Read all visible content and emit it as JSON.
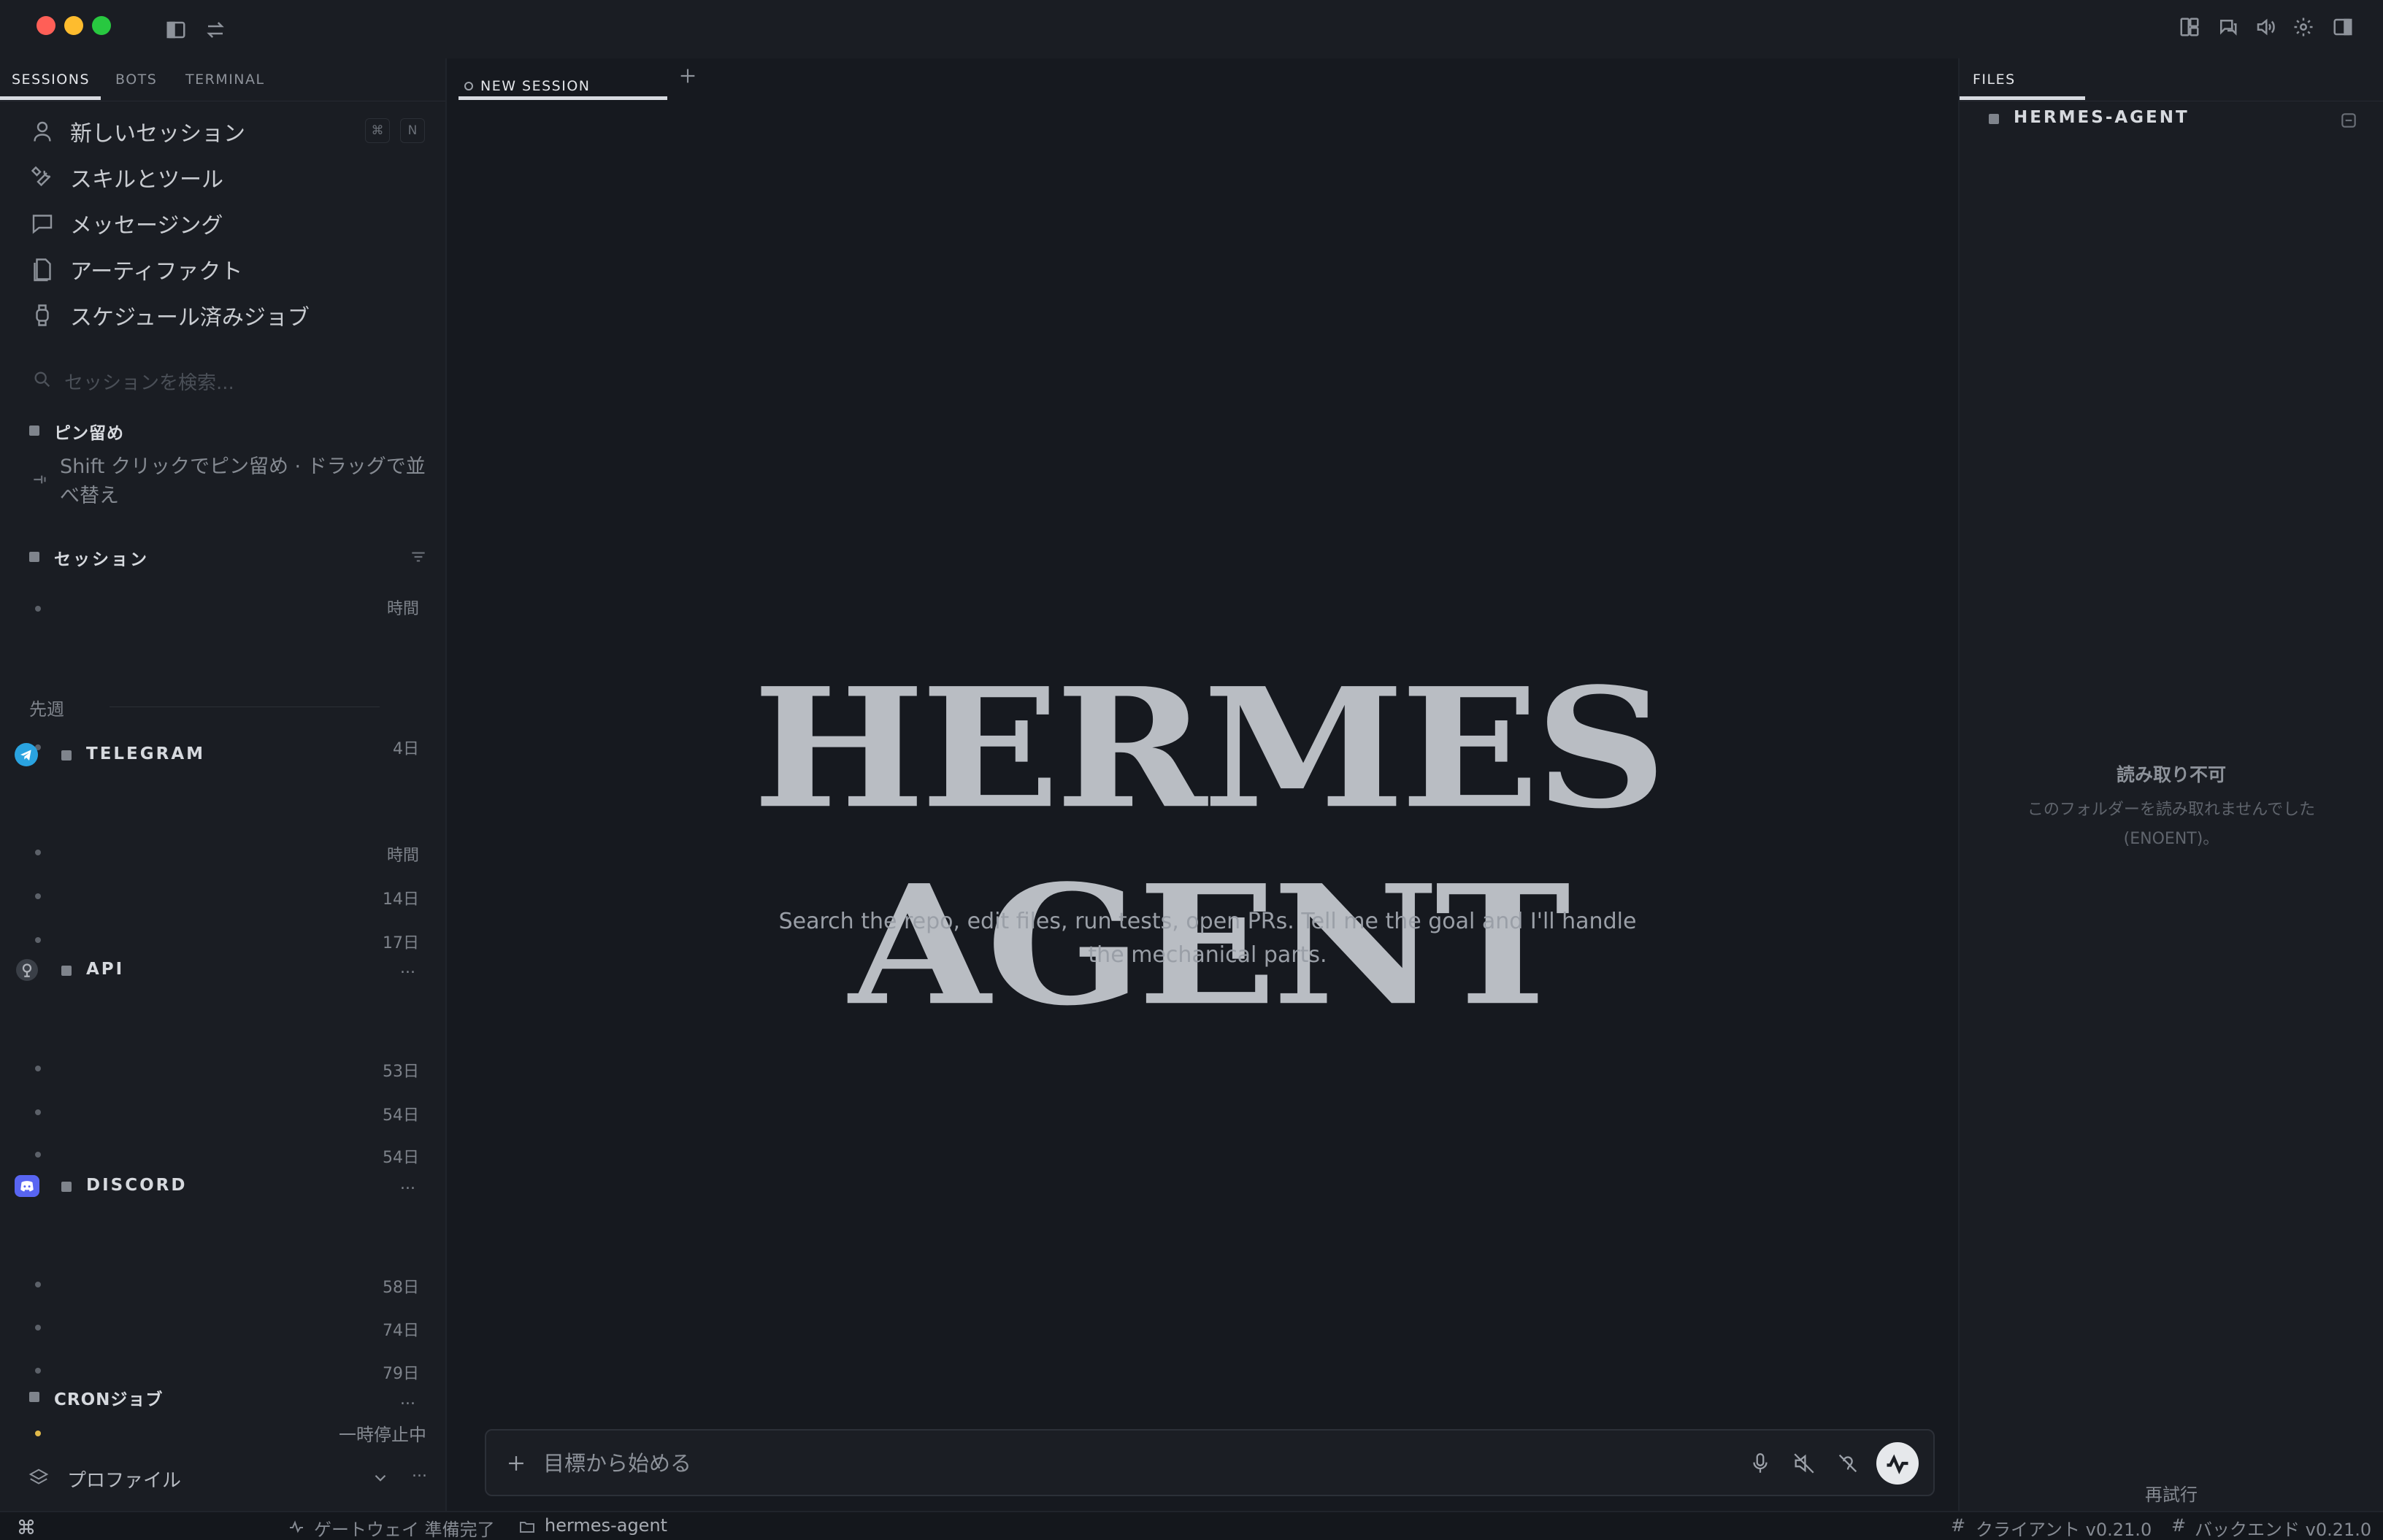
{
  "titlebar": {
    "left_icons": [
      "sidebar-toggle-icon",
      "swap-icon"
    ],
    "right_icons": [
      "layout-icon",
      "chat-icon",
      "volume-icon",
      "gear-icon",
      "panel-right-icon"
    ]
  },
  "sidebar": {
    "tabs": [
      "SESSIONS",
      "BOTS",
      "TERMINAL"
    ],
    "active_tab": "SESSIONS",
    "nav": [
      {
        "label": "新しいセッション",
        "icon": "user-icon",
        "shortcut": [
          "⌘",
          "N"
        ]
      },
      {
        "label": "スキルとツール",
        "icon": "tools-icon"
      },
      {
        "label": "メッセージング",
        "icon": "message-icon"
      },
      {
        "label": "アーティファクト",
        "icon": "file-icon"
      },
      {
        "label": "スケジュール済みジョブ",
        "icon": "watch-icon"
      }
    ],
    "search_placeholder": "セッションを検索...",
    "pinned": {
      "title": "ピン留め",
      "hint": "Shift クリックでピン留め · ドラッグで並べ替え"
    },
    "sessions": {
      "title": "セッション",
      "items": [
        {
          "age": "時間"
        }
      ],
      "group_label": "先週",
      "group_items": [
        {
          "age": "4日"
        }
      ]
    },
    "telegram": {
      "title": "TELEGRAM",
      "items": [
        {
          "age": "時間"
        },
        {
          "age": "14日"
        },
        {
          "age": "17日"
        }
      ],
      "more": "..."
    },
    "api": {
      "title": "API",
      "items": [
        {
          "age": "53日"
        },
        {
          "age": "54日"
        },
        {
          "age": "54日"
        }
      ],
      "more": "..."
    },
    "discord": {
      "title": "DISCORD",
      "items": [
        {
          "age": "58日"
        },
        {
          "age": "74日"
        },
        {
          "age": "79日"
        }
      ],
      "more": "..."
    },
    "cron": {
      "title": "CRONジョブ",
      "status": "一時停止中"
    },
    "profile": {
      "label": "プロファイル",
      "more": "..."
    }
  },
  "center": {
    "tab_label": "NEW SESSION",
    "title": "HERMES AGENT",
    "subtitle": "Search the repo, edit files, run tests, open PRs. Tell me the goal and I'll handle the mechanical parts.",
    "composer_placeholder": "目標から始める"
  },
  "files": {
    "tab_label": "FILES",
    "folder": "HERMES-AGENT",
    "error_title": "読み取り不可",
    "error_message": "このフォルダーを読み取れませんでした (ENOENT)。",
    "retry": "再試行"
  },
  "status": {
    "gateway": "ゲートウェイ 準備完了",
    "cwd": "hermes-agent",
    "client": "クライアント v0.21.0",
    "backend": "バックエンド v0.21.0"
  },
  "colors": {
    "accent_telegram": "#2aa3e0",
    "accent_discord": "#5865f2",
    "cron_dot": "#e0b94a"
  }
}
